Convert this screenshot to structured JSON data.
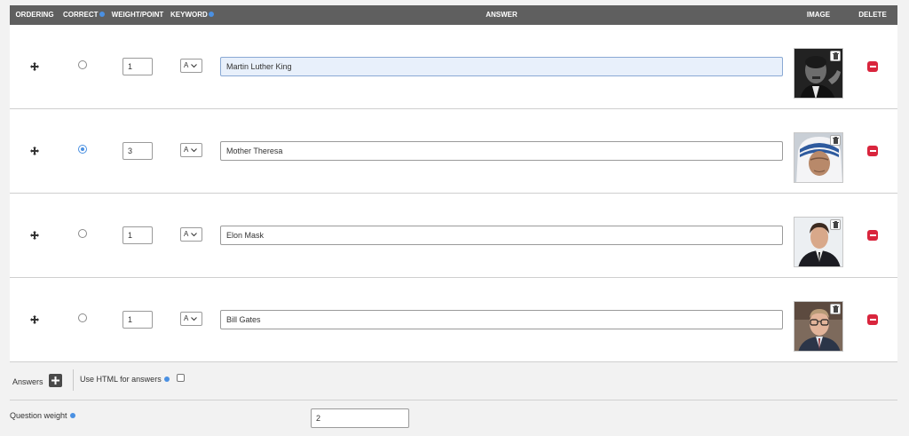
{
  "header": {
    "ordering": "ORDERING",
    "correct": "CORRECT",
    "weight_point": "WEIGHT/POINT",
    "keyword": "KEYWORD",
    "answer": "ANSWER",
    "image": "IMAGE",
    "delete": "DELETE"
  },
  "rows": [
    {
      "correct": false,
      "weight": "1",
      "keyword": "A",
      "answer": "Martin Luther King",
      "focused": true,
      "image_icon": "portrait-mlk-photo"
    },
    {
      "correct": true,
      "weight": "3",
      "keyword": "A",
      "answer": "Mother Theresa",
      "focused": false,
      "image_icon": "portrait-mother-theresa-photo"
    },
    {
      "correct": false,
      "weight": "1",
      "keyword": "A",
      "answer": "Elon Mask",
      "focused": false,
      "image_icon": "portrait-elon-photo"
    },
    {
      "correct": false,
      "weight": "1",
      "keyword": "A",
      "answer": "Bill Gates",
      "focused": false,
      "image_icon": "portrait-bill-gates-photo"
    }
  ],
  "footer": {
    "answers_label": "Answers",
    "use_html_label": "Use HTML for answers",
    "use_html_checked": false,
    "question_weight_label": "Question weight",
    "question_weight_value": "2"
  },
  "colors": {
    "header_bg": "#5f5f5f",
    "info_blue": "#4a90e2",
    "delete_red": "#d9253d",
    "focus_bg": "#e8f0fb"
  }
}
